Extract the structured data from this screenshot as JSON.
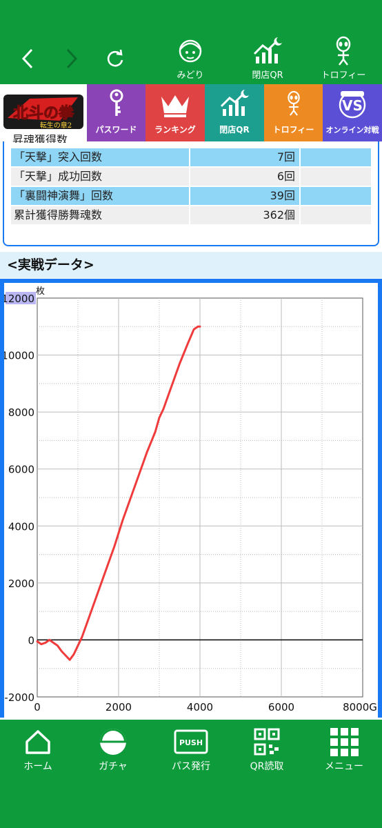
{
  "top_nav": {
    "items": [
      {
        "label": "みどり",
        "icon": "character-face-icon"
      },
      {
        "label": "閉店QR",
        "icon": "growth-chart-moon-icon"
      },
      {
        "label": "トロフィー",
        "icon": "alien-figure-icon"
      }
    ]
  },
  "game_tabs": {
    "logo_text": "北斗の拳",
    "logo_sub": "転生の章2",
    "items": [
      {
        "label": "パスワード",
        "icon": "key-icon",
        "color": "#8a44b6"
      },
      {
        "label": "ランキング",
        "icon": "crown-icon",
        "color": "#e04343"
      },
      {
        "label": "閉店QR",
        "icon": "growth-chart-moon-icon",
        "color": "#1d9f8f"
      },
      {
        "label": "トロフィー",
        "icon": "alien-figure-icon",
        "color": "#ee8a22"
      },
      {
        "label": "オンライン対戦",
        "icon": "online-vs-icon",
        "color": "#5b4fd6"
      }
    ]
  },
  "stats": {
    "partial_header": "昇魂獲得数",
    "rows": [
      {
        "label": "「天撃」突入回数",
        "value": "7回",
        "style": "blue"
      },
      {
        "label": "「天撃」成功回数",
        "value": "6回",
        "style": "gray"
      },
      {
        "label": "「裏闘神演舞」回数",
        "value": "39回",
        "style": "blue"
      },
      {
        "label": "累計獲得勝舞魂数",
        "value": "362個",
        "style": "gray"
      }
    ]
  },
  "section_title": "<実戦データ>",
  "chart_data": {
    "type": "line",
    "ylabel": "枚",
    "xlim": [
      0,
      8000
    ],
    "ylim": [
      -2000,
      12000
    ],
    "x_ticks": [
      "0",
      "2000",
      "4000",
      "6000",
      "8000G"
    ],
    "y_ticks": [
      "12000",
      "10000",
      "8000",
      "6000",
      "4000",
      "2000",
      "0",
      "-2000"
    ],
    "grid": true,
    "series": [
      {
        "color": "#ef3b3b",
        "x": [
          0,
          100,
          200,
          300,
          400,
          500,
          600,
          700,
          800,
          900,
          1000,
          1100,
          1300,
          1500,
          1700,
          1900,
          2100,
          2300,
          2500,
          2700,
          2900,
          3000,
          3100,
          3300,
          3500,
          3700,
          3850,
          3950,
          4000
        ],
        "y": [
          -50,
          -150,
          -100,
          0,
          -100,
          -200,
          -400,
          -550,
          -700,
          -500,
          -200,
          100,
          900,
          1700,
          2500,
          3300,
          4200,
          5000,
          5800,
          6600,
          7300,
          7800,
          8100,
          8900,
          9700,
          10400,
          10900,
          11000,
          11000
        ]
      }
    ]
  },
  "bottom_nav": {
    "items": [
      {
        "label": "ホーム",
        "icon": "home-icon"
      },
      {
        "label": "ガチャ",
        "icon": "gacha-ball-icon"
      },
      {
        "label": "パス発行",
        "icon": "push-ticket-icon"
      },
      {
        "label": "QR読取",
        "icon": "qr-code-icon"
      },
      {
        "label": "メニュー",
        "icon": "grid-menu-icon"
      }
    ]
  },
  "colors": {
    "brand_green": "#0e9b3c",
    "frame_blue": "#1979f2",
    "row_blue": "#8fd6f6"
  }
}
